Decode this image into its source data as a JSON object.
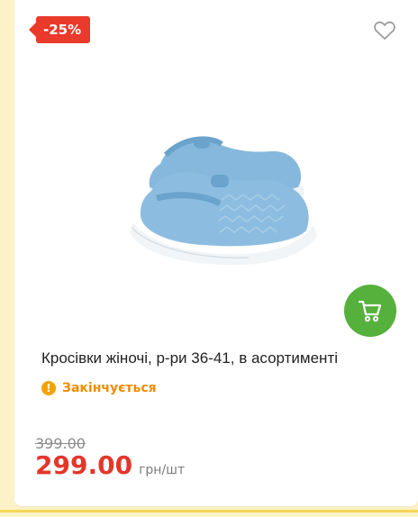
{
  "product": {
    "discount": "-25%",
    "title": "Кросівки жіночі, р-ри 36-41, в асортименті",
    "status": "Закінчується",
    "old_price": "399.00",
    "price": "299.00",
    "unit": "грн/шт",
    "image_alt": "Blue knit women's sneakers"
  },
  "icons": {
    "favorite": "heart-icon",
    "cart": "cart-icon",
    "status": "warning-icon"
  },
  "colors": {
    "discount": "#ea3a2b",
    "price": "#e3362b",
    "cart": "#55b03c",
    "status": "#f08c00",
    "background": "#fbf2c7"
  }
}
